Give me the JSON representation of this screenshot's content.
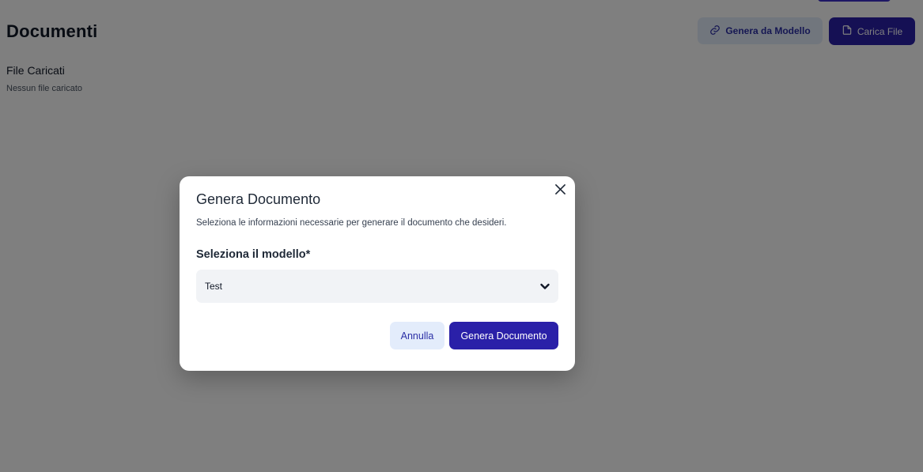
{
  "background": {
    "title": "Documenti",
    "buttons": {
      "generate_from_template": "Genera da Modello",
      "upload_file": "Carica File"
    },
    "section": {
      "title": "File Caricati",
      "empty_text": "Nessun file caricato"
    }
  },
  "modal": {
    "title": "Genera Documento",
    "description": "Seleziona le informazioni necessarie per generare il documento che desideri.",
    "field_label": "Seleziona il modello*",
    "selected_template": "Test",
    "cancel_label": "Annulla",
    "submit_label": "Genera Documento"
  },
  "colors": {
    "primary": "#2a20a8",
    "secondary_bg": "#e3ecfb",
    "overlay": "rgba(0,0,0,0.5)"
  },
  "icons": {
    "close": "close-icon",
    "chevron": "chevron-down-icon",
    "link": "link-icon",
    "file": "file-icon"
  }
}
